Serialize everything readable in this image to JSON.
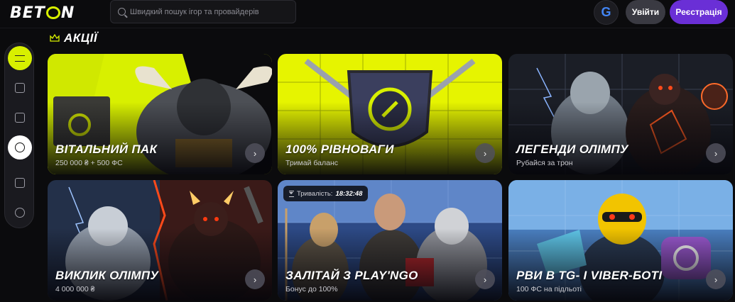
{
  "header": {
    "logo": "BETON",
    "search_placeholder": "Швидкий пошук ігор та провайдерів",
    "google_label": "G",
    "login_label": "Увійти",
    "register_label": "Реєстрація"
  },
  "sidebar": {
    "items": [
      {
        "icon": "menu-icon",
        "state": "active"
      },
      {
        "icon": "gamepad-icon",
        "state": "default"
      },
      {
        "icon": "cards-icon",
        "state": "default"
      },
      {
        "icon": "power-icon",
        "state": "selected"
      },
      {
        "icon": "gift-icon",
        "state": "default"
      },
      {
        "icon": "headset-icon",
        "state": "default"
      }
    ]
  },
  "section": {
    "title": "АКЦІЇ",
    "icon": "crown-icon"
  },
  "promos": [
    {
      "title": "ВІТАЛЬНИЙ ПАК",
      "subtitle": "250 000 ₴ + 500 ФС",
      "bg": "#d8f000",
      "accent": "#2a2a2a"
    },
    {
      "title": "100% РІВНОВАГИ",
      "subtitle": "Тримай баланс",
      "bg": "#e6f400",
      "accent": "#3b3f5e"
    },
    {
      "title": "ЛЕГЕНДИ ОЛІМПУ",
      "subtitle": "Рубайся за трон",
      "bg": "#1b1e26",
      "accent": "#ff5a1f"
    },
    {
      "title": "ВИКЛИК ОЛІМПУ",
      "subtitle": "4 000 000 ₴",
      "bg": "#233049",
      "accent": "#e2361a"
    },
    {
      "title": "ЗАЛІТАЙ З PLAY'NGO",
      "subtitle": "Бонус до 100%",
      "bg": "#2d4a86",
      "accent": "#c8a06a",
      "timer_label": "Тривалість:",
      "timer_value": "18:32:48"
    },
    {
      "title": "РВИ В TG- І VIBER-БОТІ",
      "subtitle": "100 ФС на підльоті",
      "bg": "#4a7fc0",
      "accent": "#f2c400"
    }
  ],
  "arrow_symbol": "›"
}
